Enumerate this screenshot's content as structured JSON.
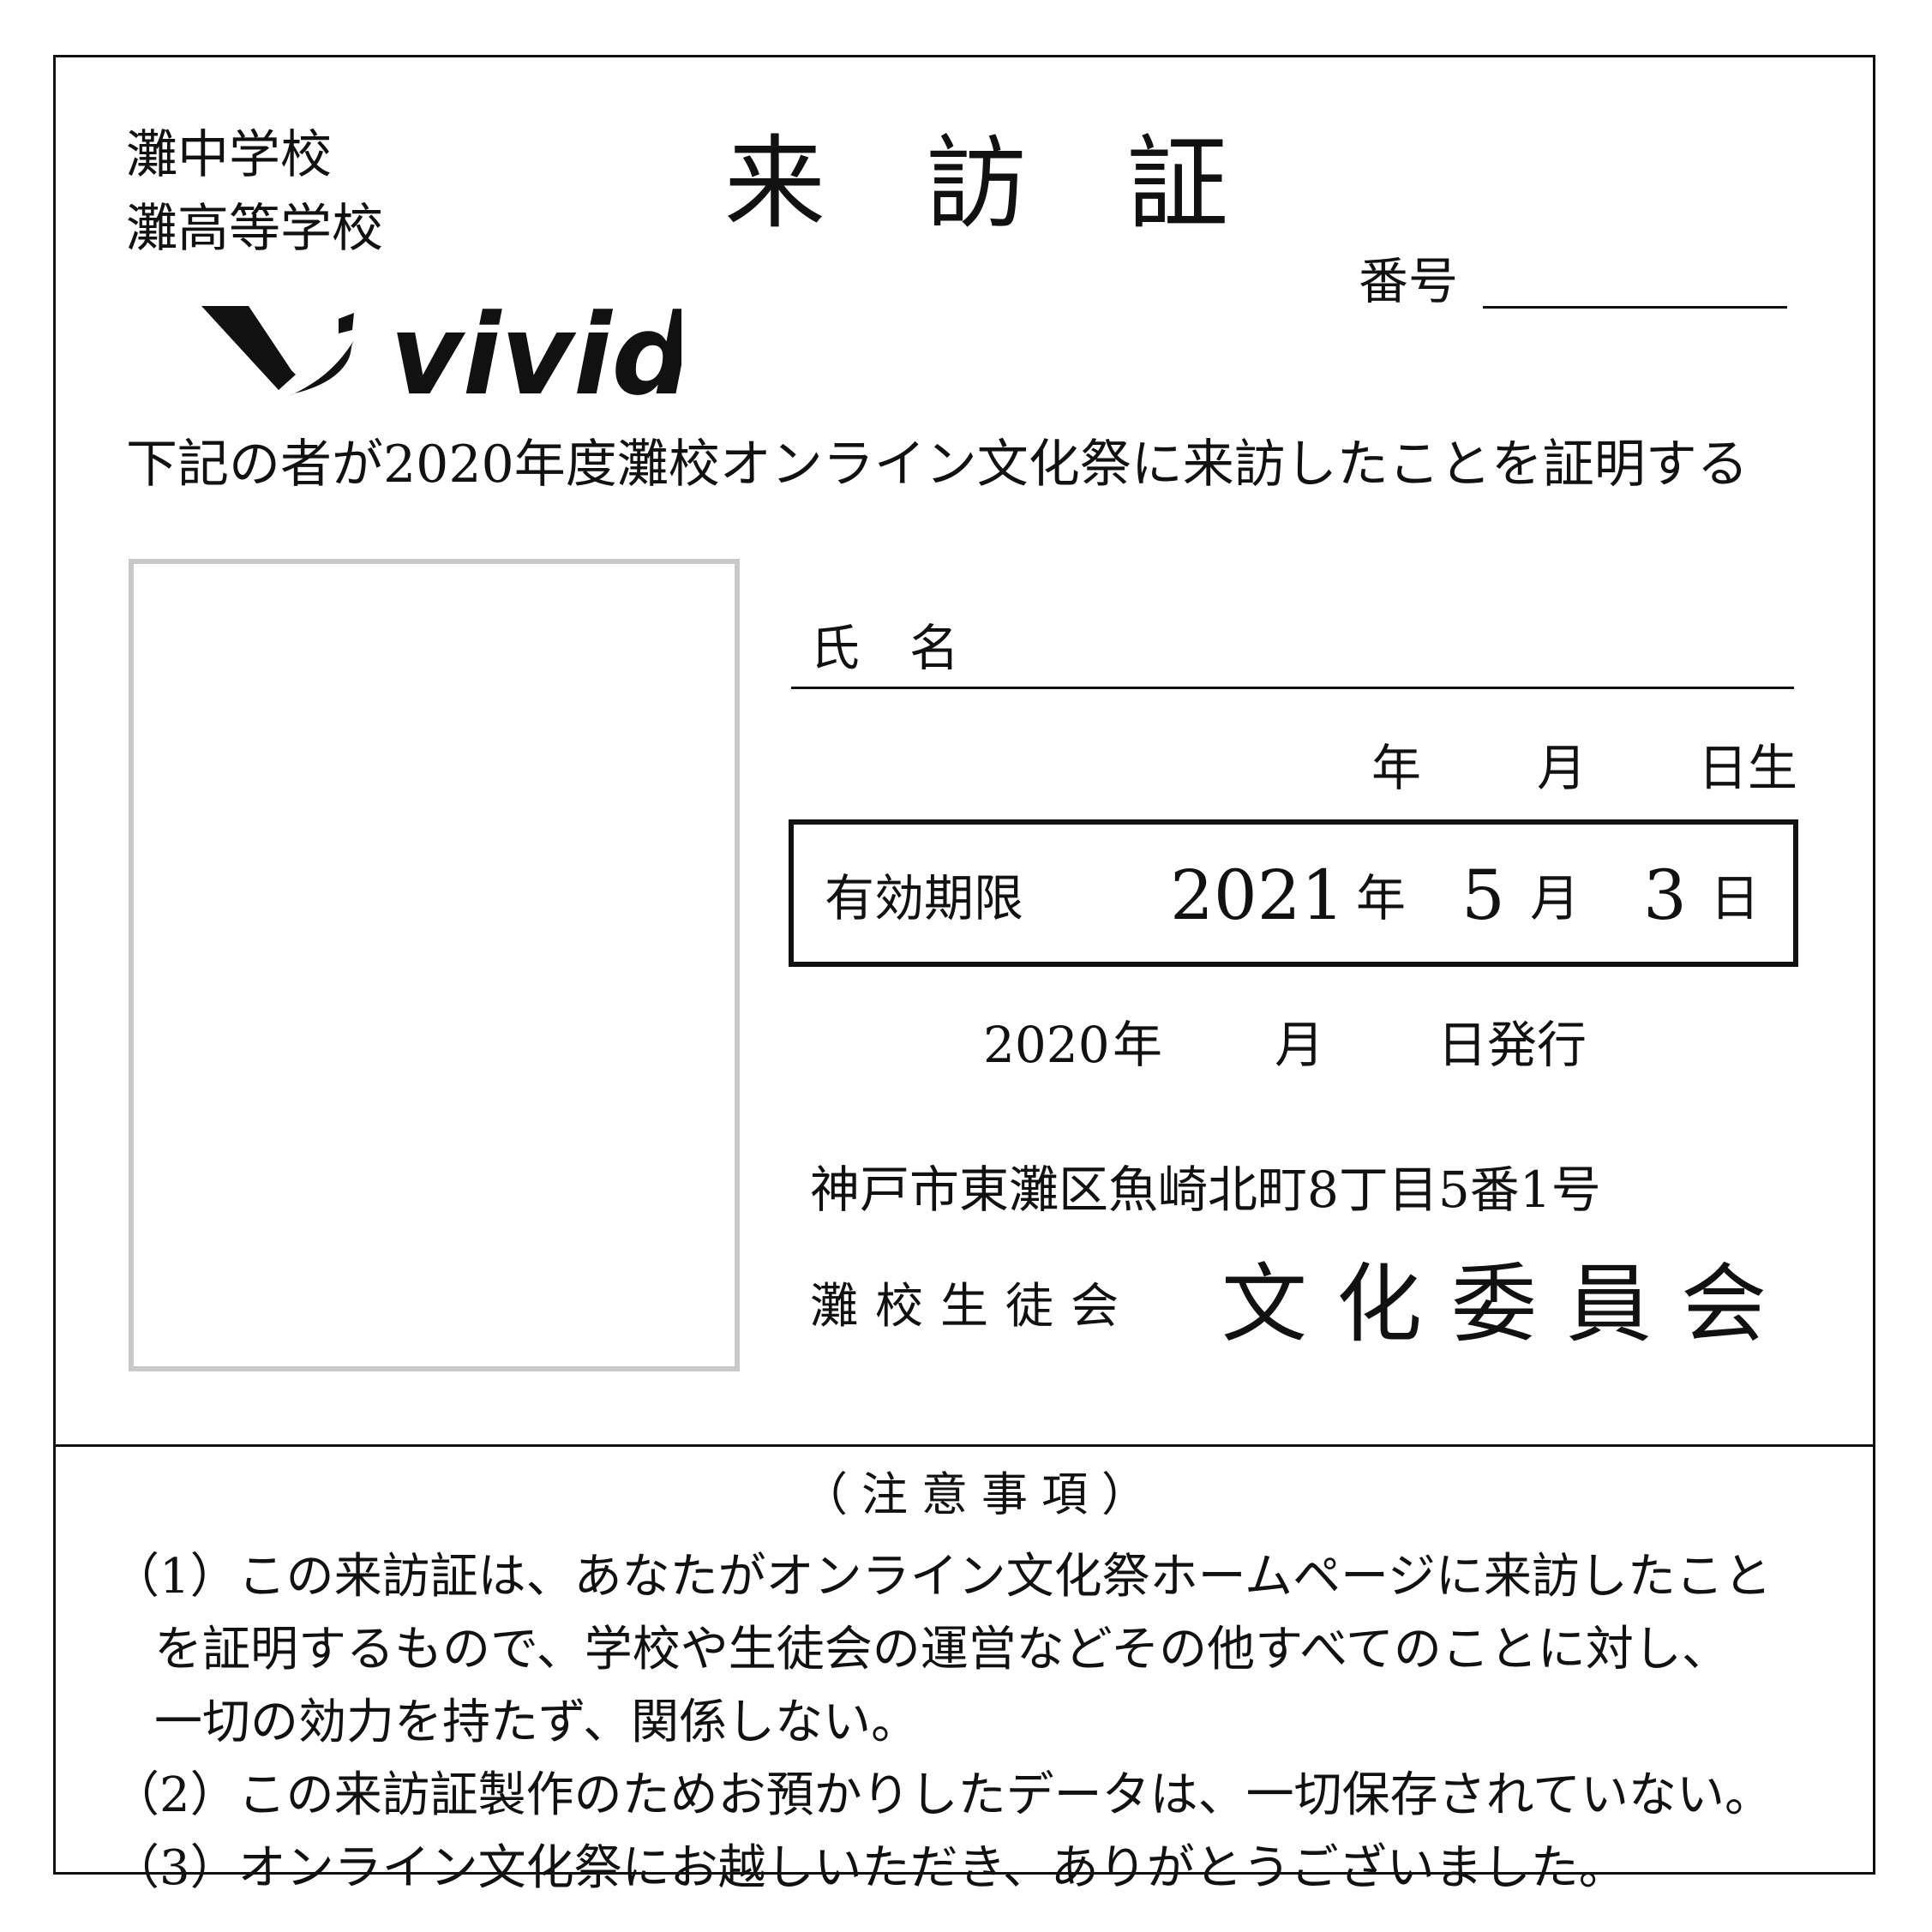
{
  "header": {
    "school_line1": "灘中学校",
    "school_line2": "灘高等学校",
    "title_chars": [
      "来",
      "訪",
      "証"
    ],
    "number_label": "番号",
    "logo_text": "vivid"
  },
  "statement": "下記の者が2020年度灘校オンライン文化祭に来訪したことを証明する",
  "form": {
    "name_label": "氏　名",
    "birth_year_unit": "年",
    "birth_month_unit": "月",
    "birth_day_unit": "日生",
    "expiry": {
      "label": "有効期限",
      "year": "2021",
      "year_unit": "年",
      "month": "5",
      "month_unit": "月",
      "day": "3",
      "day_unit": "日"
    },
    "issue": {
      "year": "2020",
      "year_unit": "年",
      "month_unit": "月",
      "day_unit": "日発行"
    },
    "address": "神戸市東灘区魚崎北町8丁目5番1号",
    "council": "灘校生徒会",
    "committee": "文化委員会"
  },
  "notes": {
    "title": "（注意事項）",
    "items": [
      "（1）この来訪証は、あなたがオンライン文化祭ホームページに来訪したこと",
      "を証明するもので、学校や生徒会の運営などその他すべてのことに対し、",
      "一切の効力を持たず、関係しない。",
      "（2）この来訪証製作のためお預かりしたデータは、一切保存されていない。",
      "（3）オンライン文化祭にお越しいただき、ありがとうございました。"
    ]
  }
}
